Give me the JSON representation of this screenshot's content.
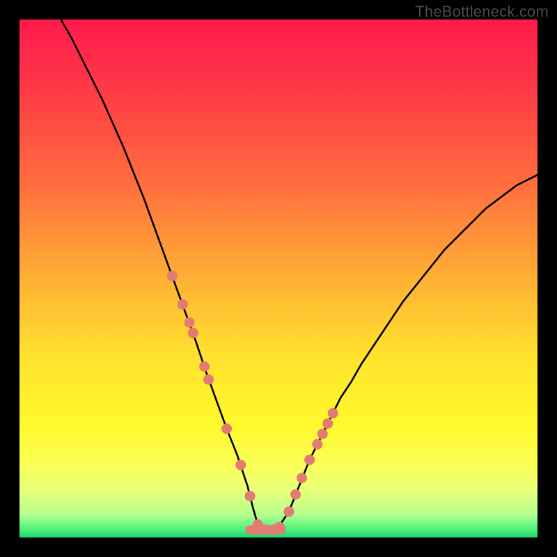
{
  "watermark": "TheBottleneck.com",
  "gradient": {
    "stops": [
      {
        "offset": 0.0,
        "color": "#ff1a4c"
      },
      {
        "offset": 0.12,
        "color": "#ff3647"
      },
      {
        "offset": 0.32,
        "color": "#ff6e3e"
      },
      {
        "offset": 0.5,
        "color": "#ffb034"
      },
      {
        "offset": 0.65,
        "color": "#ffe22e"
      },
      {
        "offset": 0.78,
        "color": "#fff92c"
      },
      {
        "offset": 0.86,
        "color": "#faff55"
      },
      {
        "offset": 0.91,
        "color": "#e7ff7a"
      },
      {
        "offset": 0.955,
        "color": "#b6ff8f"
      },
      {
        "offset": 0.985,
        "color": "#4cf07b"
      },
      {
        "offset": 1.0,
        "color": "#18d36b"
      }
    ]
  },
  "chart_data": {
    "type": "line",
    "title": "",
    "xlabel": "",
    "ylabel": "",
    "xlim": [
      0,
      100
    ],
    "ylim": [
      0,
      100
    ],
    "series": [
      {
        "name": "curve",
        "x": [
          8,
          10,
          12,
          14,
          16,
          18,
          20,
          22,
          24,
          26,
          28,
          30,
          32,
          34,
          36,
          38,
          40,
          42,
          44,
          45,
          46,
          47,
          48,
          49,
          50,
          52,
          54,
          56,
          58,
          60,
          62,
          64,
          66,
          68,
          70,
          72,
          74,
          76,
          78,
          80,
          82,
          84,
          86,
          88,
          90,
          92,
          94,
          96,
          98,
          100
        ],
        "values": [
          100,
          96.5,
          92.5,
          88.5,
          84.5,
          80.0,
          75.5,
          70.5,
          65.5,
          60.0,
          54.5,
          49.0,
          43.5,
          38.0,
          32.0,
          26.5,
          21.0,
          16.0,
          10.0,
          6.0,
          2.5,
          1.5,
          1.5,
          1.5,
          2.0,
          5.0,
          10.0,
          15.0,
          19.0,
          23.0,
          27.0,
          30.0,
          33.5,
          36.5,
          39.5,
          42.5,
          45.5,
          48.0,
          50.5,
          53.0,
          55.5,
          57.5,
          59.5,
          61.5,
          63.5,
          65.0,
          66.5,
          68.0,
          69.0,
          70.0
        ]
      }
    ],
    "markers": {
      "name": "points",
      "x": [
        29.5,
        31.5,
        32.8,
        33.5,
        35.7,
        36.5,
        40.0,
        42.7,
        44.5,
        46.0,
        47.5,
        49.0,
        50.2,
        52.0,
        53.3,
        54.5,
        56.0,
        57.5,
        58.5,
        59.5,
        60.5
      ],
      "values": [
        50.5,
        45.0,
        41.5,
        39.5,
        33.0,
        30.5,
        21.0,
        14.0,
        8.0,
        2.5,
        1.5,
        1.5,
        2.0,
        5.0,
        8.3,
        11.5,
        15.0,
        18.0,
        20.0,
        22.0,
        24.0
      ]
    },
    "flat_segment": {
      "x": [
        44.5,
        50.5
      ],
      "y": 1.5
    }
  }
}
